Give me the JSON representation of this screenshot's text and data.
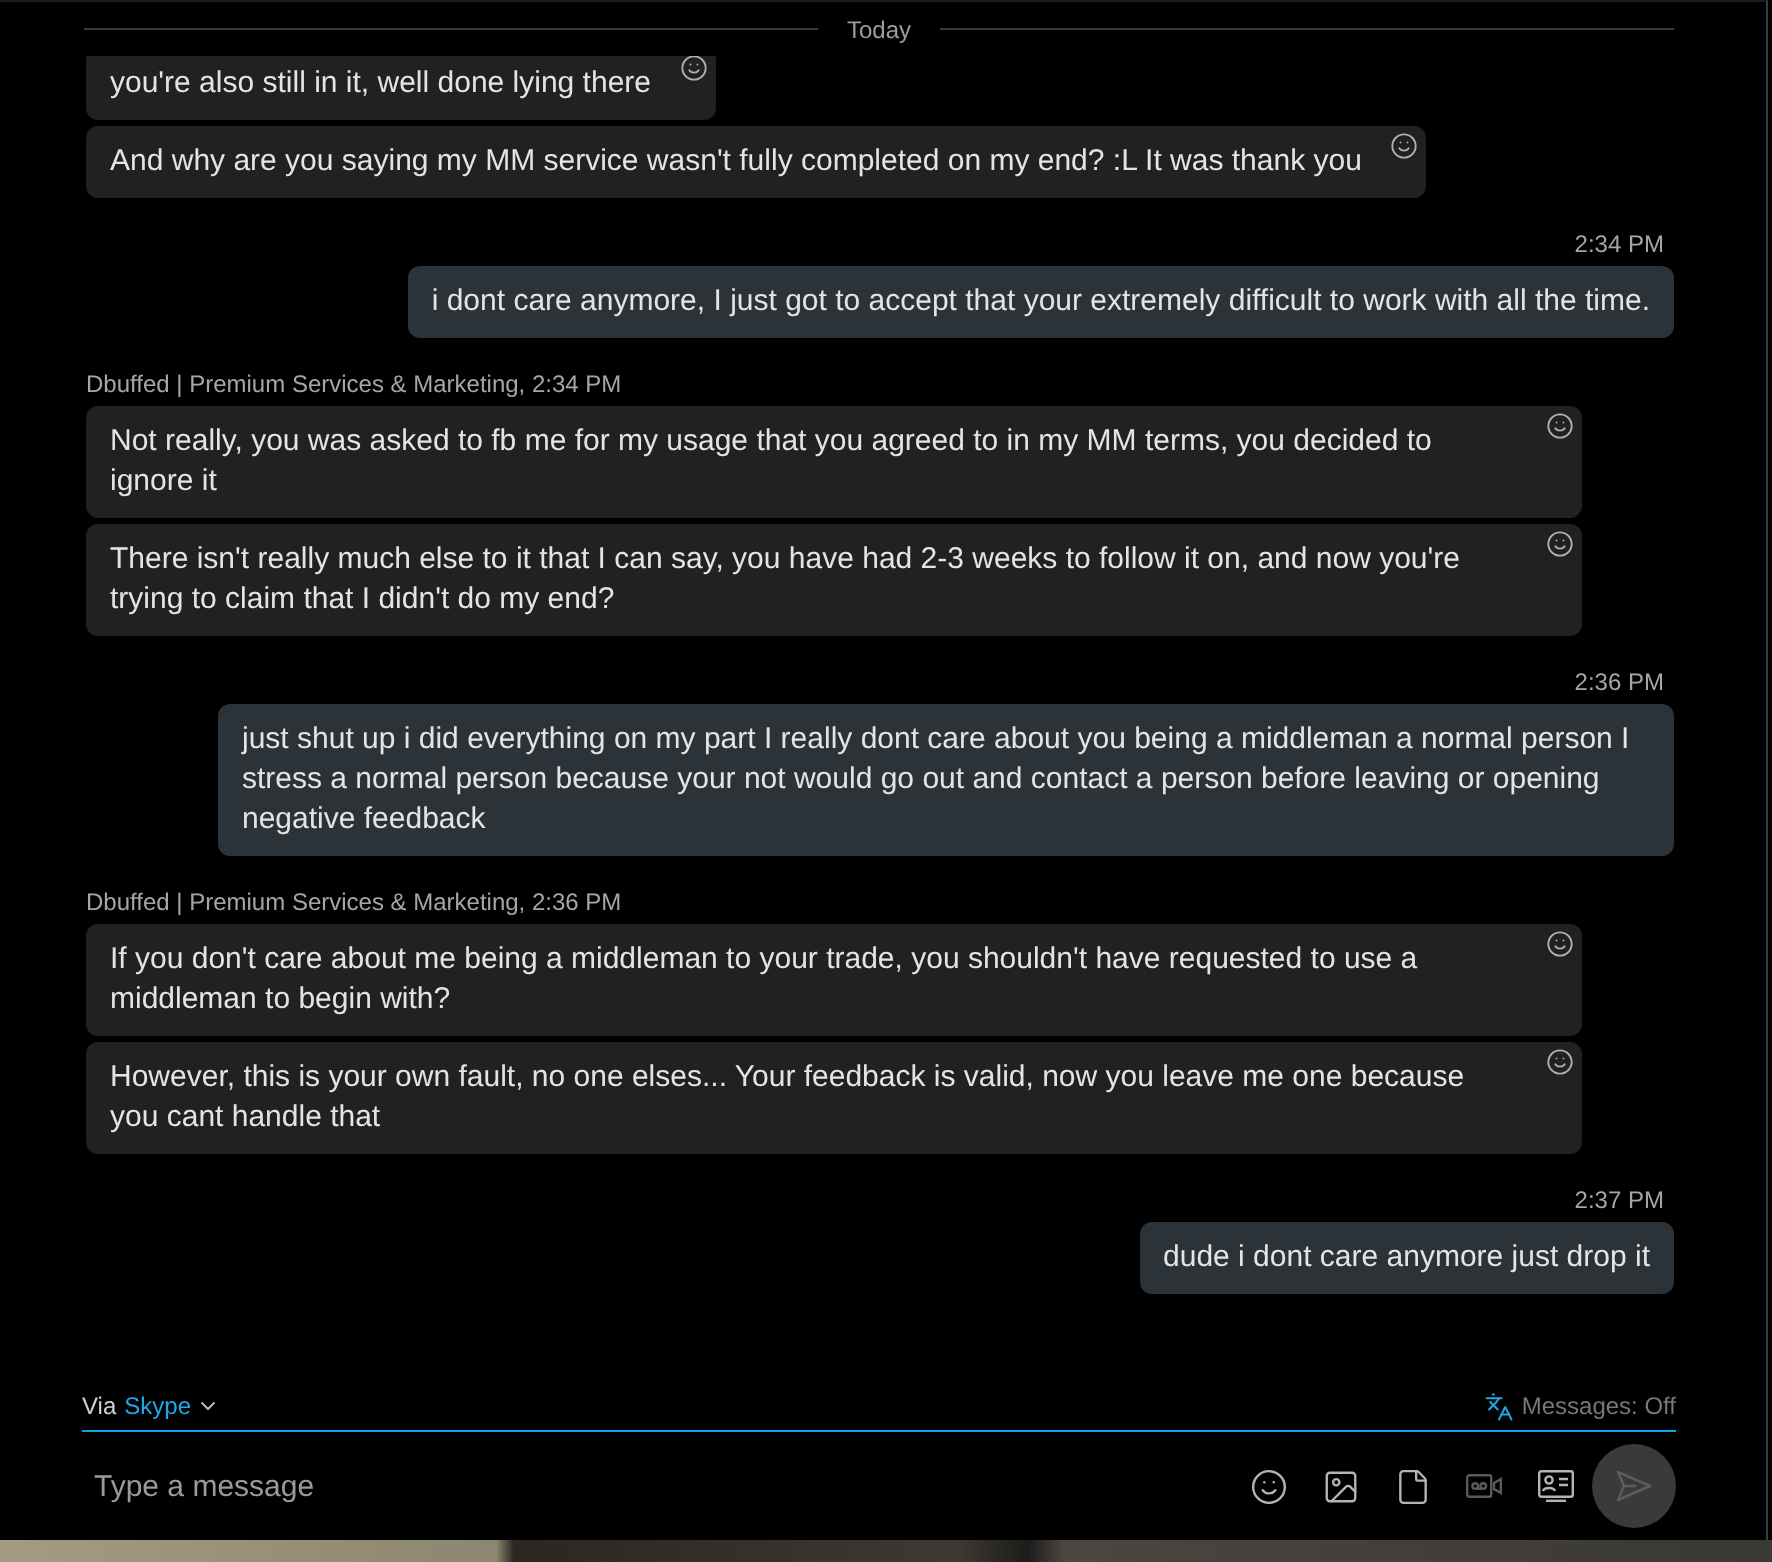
{
  "divider": {
    "label": "Today"
  },
  "conversation": [
    {
      "kind": "incoming",
      "messages": [
        "you're also still in it, well done lying there",
        "And why are you saying my MM service wasn't fully completed on my end? :L It was thank you"
      ]
    },
    {
      "kind": "outgoing",
      "time": "2:34 PM",
      "messages": [
        "i dont care anymore, I just got to accept that your extremely difficult to work with all the time."
      ]
    },
    {
      "kind": "incoming",
      "header": "Dbuffed | Premium Services & Marketing, 2:34 PM",
      "messages": [
        "Not really, you was asked to fb me for my usage that you agreed to in my MM terms, you decided to ignore it",
        "There isn't really much else to it that I can say, you have had 2-3 weeks to follow it on, and now you're trying to claim that I didn't do my end?"
      ]
    },
    {
      "kind": "outgoing",
      "time": "2:36 PM",
      "messages": [
        "just shut up i did everything on my part I really dont care about you being a middleman a normal person I stress a normal person because your not would go out and contact a person before leaving or opening negative feedback"
      ]
    },
    {
      "kind": "incoming",
      "header": "Dbuffed | Premium Services & Marketing, 2:36 PM",
      "messages": [
        "If you don't care about me being a middleman to your trade, you shouldn't have requested to use a middleman to begin with?",
        "However, this is your own fault, no one elses... Your feedback is valid, now you leave me one because you cant handle that"
      ]
    },
    {
      "kind": "outgoing",
      "time": "2:37 PM",
      "messages": [
        "dude i dont care anymore just drop it"
      ]
    }
  ],
  "composer": {
    "via_label": "Via",
    "service": "Skype",
    "translator_status": "Messages: Off",
    "placeholder": "Type a message",
    "tools": [
      {
        "kind": "emoji",
        "disabled": false
      },
      {
        "kind": "image",
        "disabled": false
      },
      {
        "kind": "file",
        "disabled": false
      },
      {
        "kind": "video_message",
        "disabled": true
      },
      {
        "kind": "contact",
        "disabled": false
      }
    ],
    "send": {
      "disabled": true
    }
  }
}
